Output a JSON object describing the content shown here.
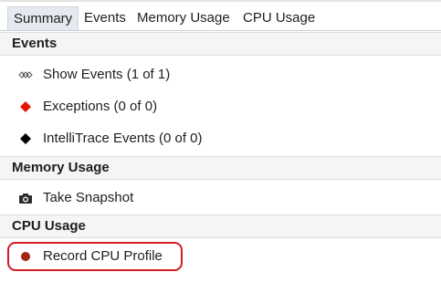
{
  "tabs": [
    {
      "label": "Summary",
      "active": true
    },
    {
      "label": "Events",
      "active": false
    },
    {
      "label": "Memory Usage",
      "active": false
    },
    {
      "label": "CPU Usage",
      "active": false
    }
  ],
  "sections": {
    "events": {
      "title": "Events",
      "items": [
        {
          "label": "Show Events (1 of 1)",
          "icon": "events-icon"
        },
        {
          "label": "Exceptions (0 of 0)",
          "icon": "red-diamond-icon"
        },
        {
          "label": "IntelliTrace Events (0 of 0)",
          "icon": "black-diamond-icon"
        }
      ]
    },
    "memory": {
      "title": "Memory Usage",
      "items": [
        {
          "label": "Take Snapshot",
          "icon": "camera-icon"
        }
      ]
    },
    "cpu": {
      "title": "CPU Usage",
      "items": [
        {
          "label": "Record CPU Profile",
          "icon": "record-icon"
        }
      ]
    }
  },
  "colors": {
    "exception_diamond": "#e51400",
    "intellitrace_diamond": "#000000",
    "record_dot": "#a1260d",
    "callout": "#d11d23"
  }
}
